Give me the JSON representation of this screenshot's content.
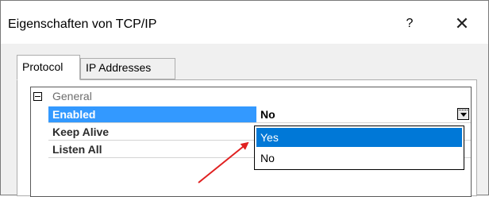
{
  "window": {
    "title": "Eigenschaften von TCP/IP",
    "help_label": "?",
    "close_label": "✕"
  },
  "tabs": [
    {
      "label": "Protocol",
      "active": true
    },
    {
      "label": "IP Addresses",
      "active": false
    }
  ],
  "property_grid": {
    "category": "General",
    "rows": [
      {
        "name": "Enabled",
        "value": "No",
        "selected": true
      },
      {
        "name": "Keep Alive",
        "value": "",
        "selected": false
      },
      {
        "name": "Listen All",
        "value": "",
        "selected": false
      }
    ]
  },
  "dropdown": {
    "options": [
      "Yes",
      "No"
    ],
    "highlighted": "Yes"
  },
  "annotation": {
    "arrow_color": "#e02020"
  },
  "colors": {
    "selection": "#3399ff",
    "list_highlight": "#0078d7"
  }
}
